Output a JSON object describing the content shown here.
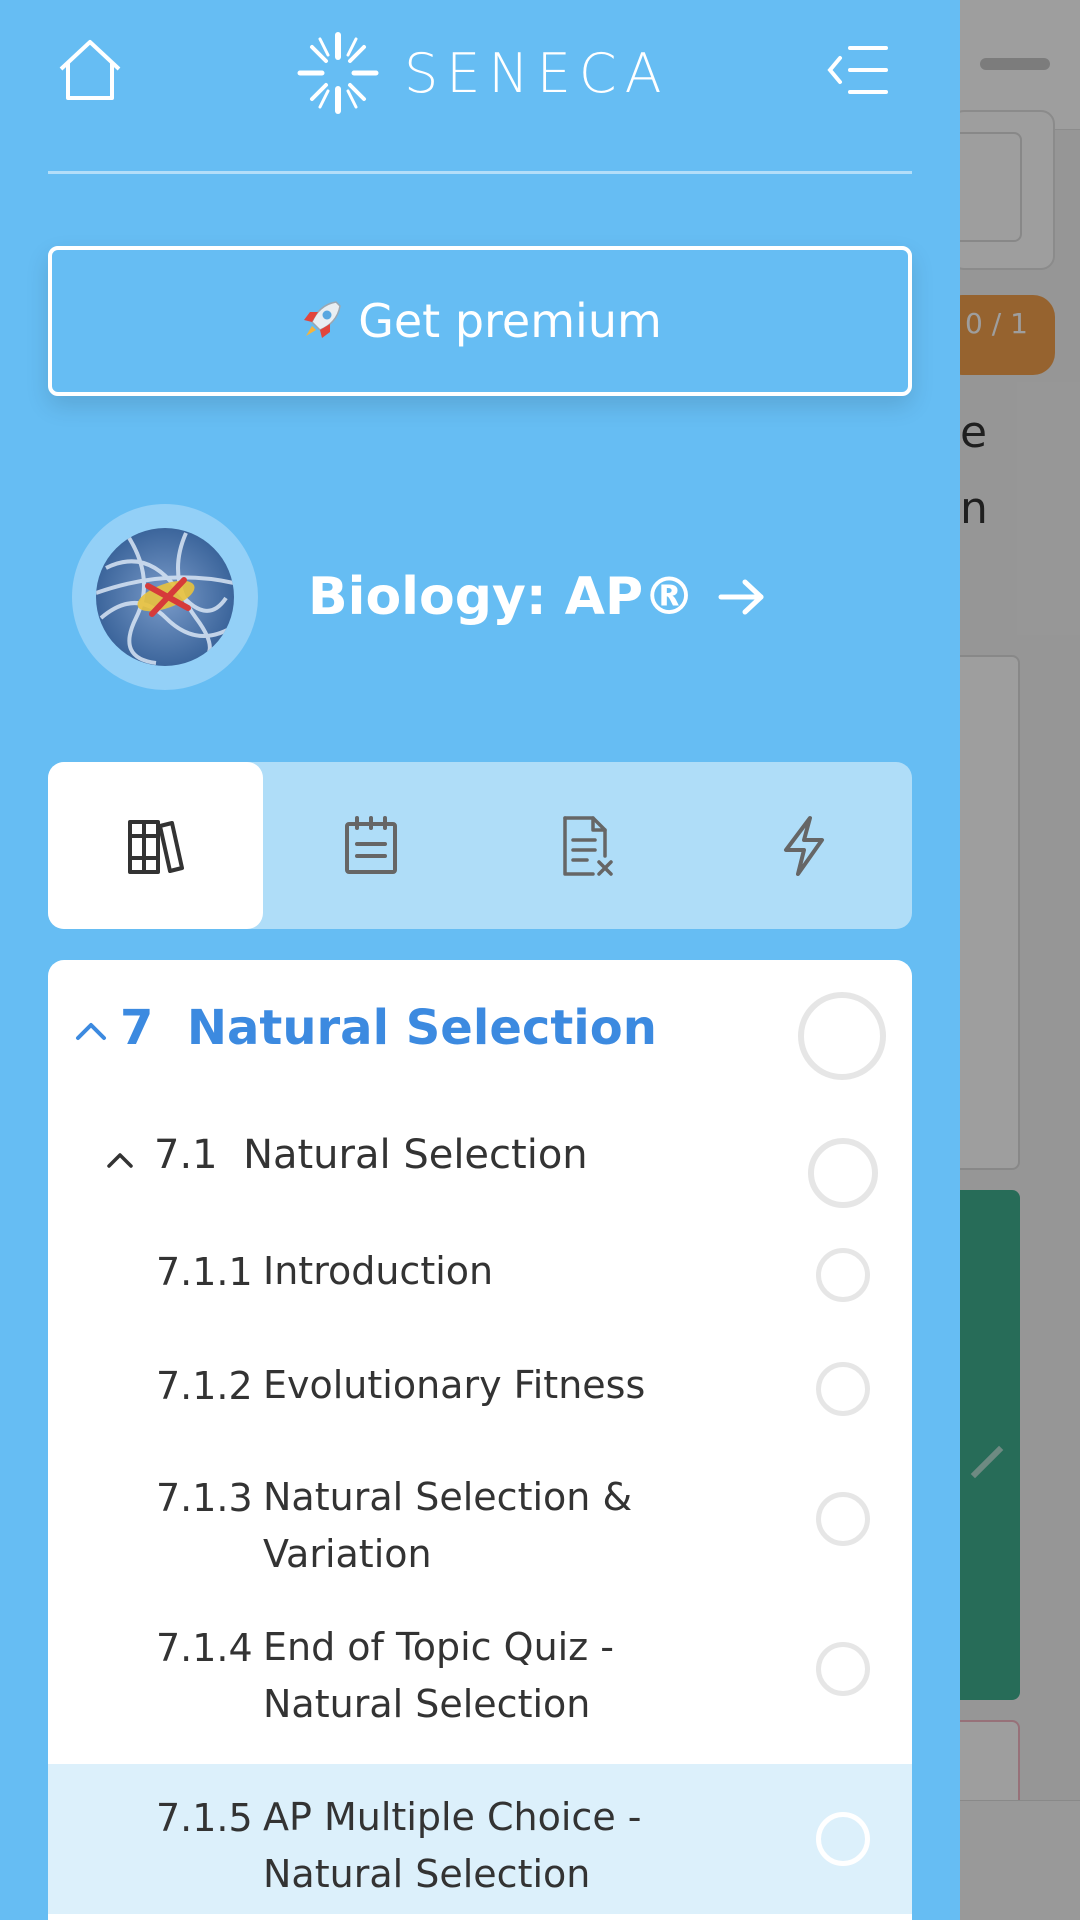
{
  "header": {
    "logo_text": "SENECA",
    "home_icon": "home-icon",
    "collapse_icon": "collapse-menu-icon"
  },
  "premium": {
    "label": "Get premium",
    "icon": "rocket-icon"
  },
  "course": {
    "title": "Biology: AP®",
    "arrow_icon": "arrow-right-icon"
  },
  "tabs": [
    {
      "icon": "books-icon",
      "active": true
    },
    {
      "icon": "notepad-icon",
      "active": false
    },
    {
      "icon": "exam-paper-icon",
      "active": false
    },
    {
      "icon": "lightning-icon",
      "active": false
    }
  ],
  "toc": {
    "topic": {
      "number": "7",
      "title": "Natural Selection"
    },
    "subtopic": {
      "number": "7.1",
      "title": "Natural Selection"
    },
    "items": [
      {
        "number": "7.1.1",
        "title": "Introduction"
      },
      {
        "number": "7.1.2",
        "title": "Evolutionary Fitness"
      },
      {
        "number": "7.1.3",
        "title": "Natural Selection & Variation"
      },
      {
        "number": "7.1.4",
        "title": "End of Topic Quiz - Natural Selection"
      },
      {
        "number": "7.1.5",
        "title": "AP Multiple Choice - Natural Selection",
        "selected": true
      }
    ]
  },
  "background": {
    "counter_num": "0",
    "counter_den": "1",
    "text_line1": "e",
    "text_line2": "n"
  },
  "colors": {
    "drawer": "#66bdf3",
    "topic_accent": "#3c8ae0",
    "selected_row": "#dcf0fb"
  }
}
